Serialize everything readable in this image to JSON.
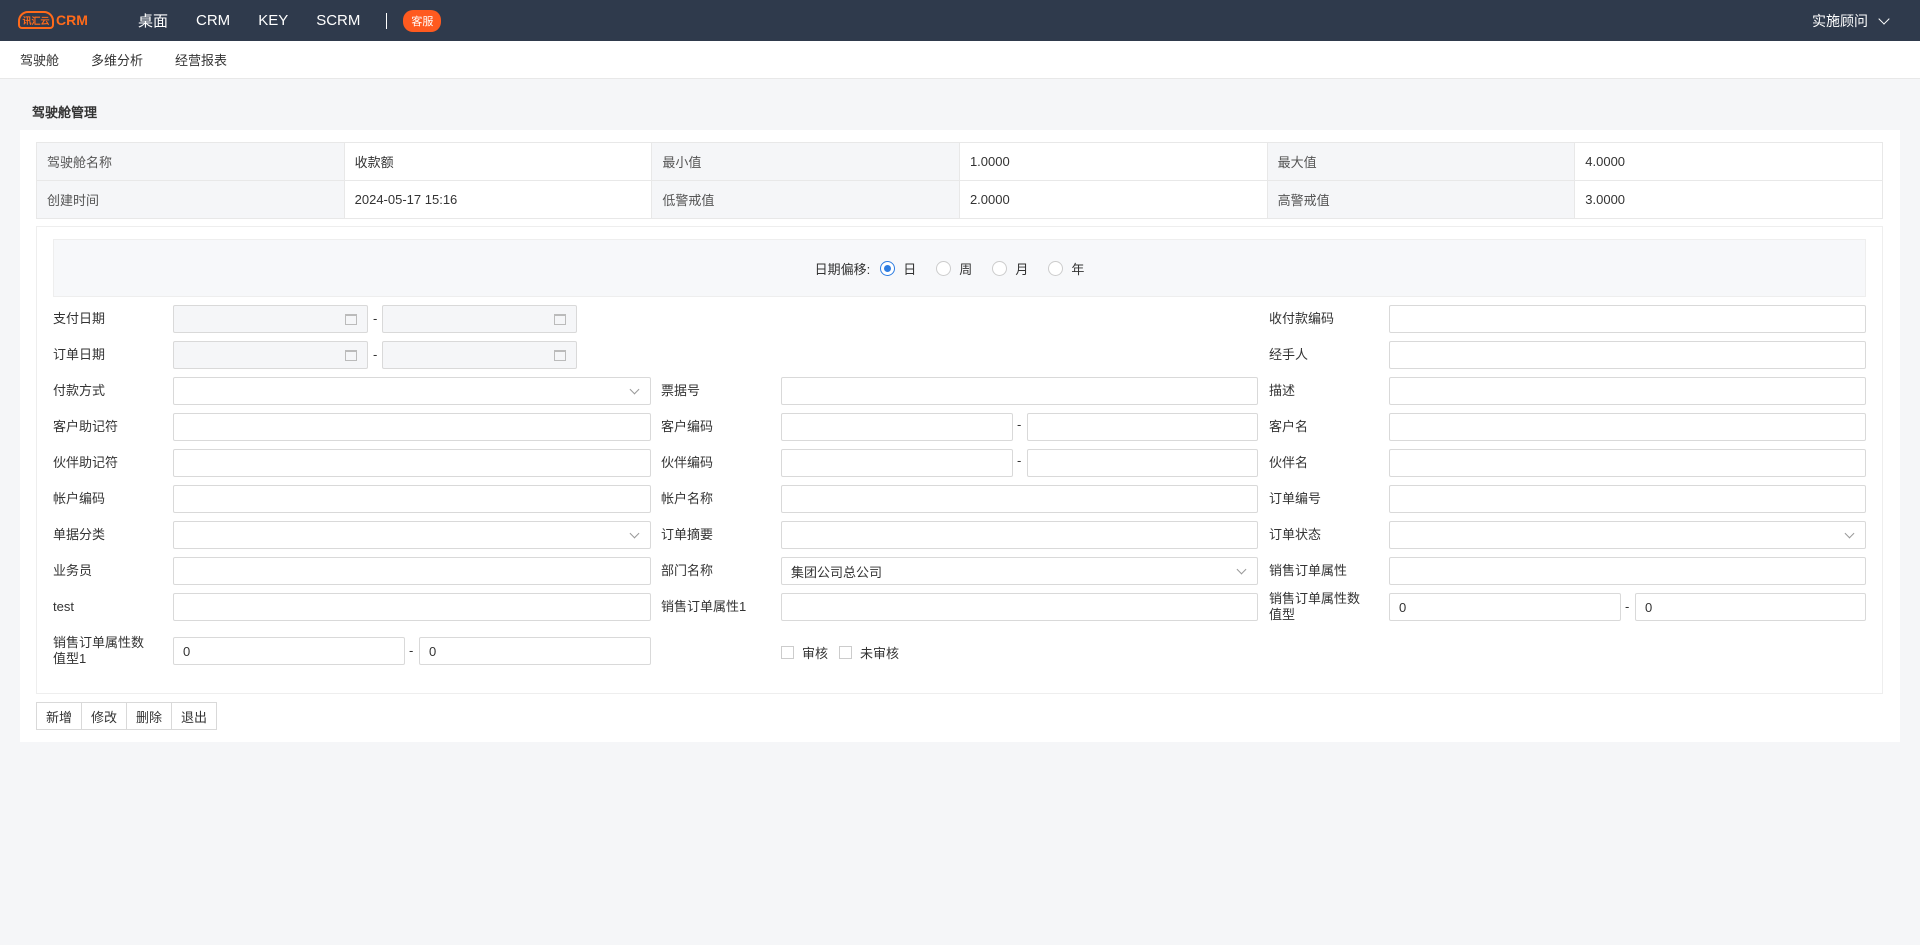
{
  "app": {
    "logo_mark": "讯汇云",
    "logo_text": "CRM"
  },
  "topnav": {
    "items": [
      "桌面",
      "CRM",
      "KEY",
      "SCRM"
    ],
    "badge": "客服",
    "user": "实施顾问"
  },
  "subnav": {
    "items": [
      "驾驶舱",
      "多维分析",
      "经营报表"
    ]
  },
  "page_title": "驾驶舱管理",
  "info": {
    "rows": [
      [
        "驾驶舱名称",
        "收款额",
        "最小值",
        "1.0000",
        "最大值",
        "4.0000"
      ],
      [
        "创建时间",
        "2024-05-17 15:16",
        "低警戒值",
        "2.0000",
        "高警戒值",
        "3.0000"
      ]
    ]
  },
  "date_offset": {
    "label": "日期偏移:",
    "options": [
      "日",
      "周",
      "月",
      "年"
    ],
    "selected": "日"
  },
  "form": {
    "pay_date": "支付日期",
    "order_date": "订单日期",
    "pay_method": "付款方式",
    "customer_mnemonic": "客户助记符",
    "partner_mnemonic": "伙伴助记符",
    "account_code": "帐户编码",
    "doc_category": "单据分类",
    "salesman": "业务员",
    "test": "test",
    "sales_attr_num1_line1": "销售订单属性数",
    "sales_attr_num1_line2": "值型1",
    "sales_attr_num1_from": "0",
    "sales_attr_num1_to": "0",
    "bill_no": "票据号",
    "customer_code": "客户编码",
    "partner_code": "伙伴编码",
    "account_name": "帐户名称",
    "order_summary": "订单摘要",
    "dept_name": "部门名称",
    "dept_value": "集团公司总公司",
    "sales_attr1": "销售订单属性1",
    "approved": "审核",
    "unapproved": "未审核",
    "receipt_code": "收付款编码",
    "handler": "经手人",
    "description": "描述",
    "customer_name": "客户名",
    "partner_name": "伙伴名",
    "order_no": "订单编号",
    "order_status": "订单状态",
    "sales_attr": "销售订单属性",
    "sales_attr_num_line1": "销售订单属性数",
    "sales_attr_num_line2": "值型",
    "sales_attr_num_from": "0",
    "sales_attr_num_to": "0"
  },
  "buttons": {
    "add": "新增",
    "edit": "修改",
    "delete": "删除",
    "exit": "退出"
  }
}
